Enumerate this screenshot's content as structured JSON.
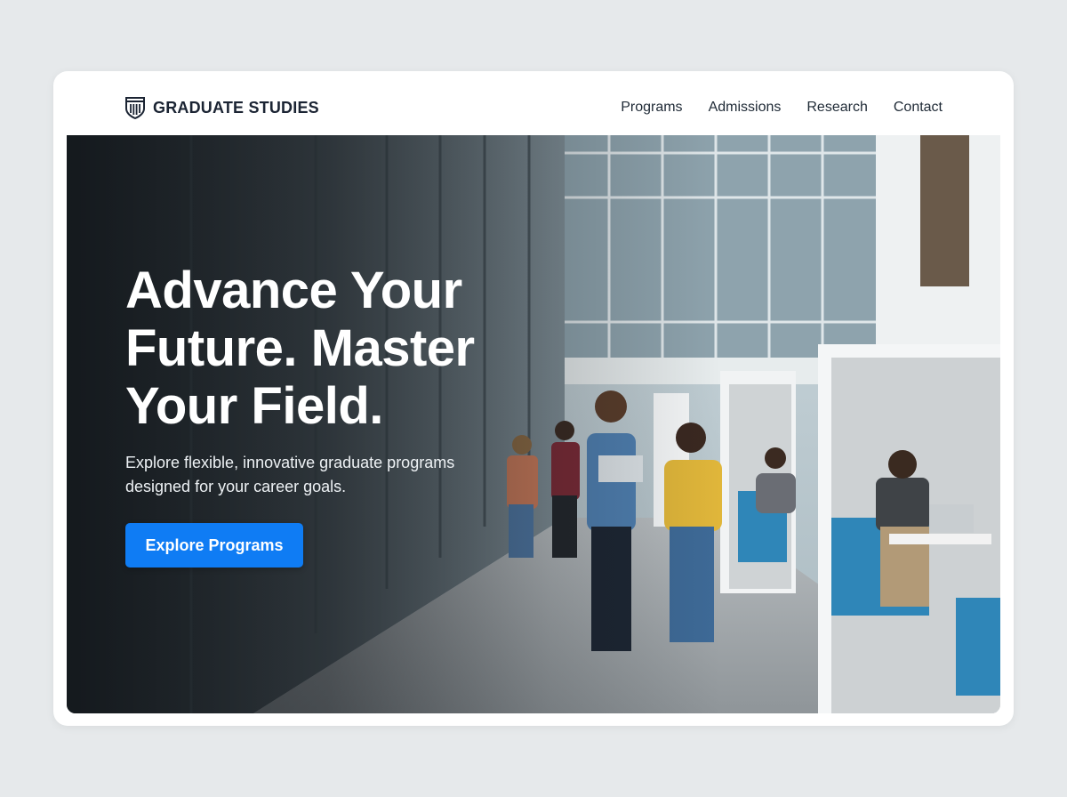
{
  "brand": {
    "name": "GRADUATE STUDIES",
    "logo_icon": "university-shield-icon"
  },
  "nav": {
    "items": [
      {
        "label": "Programs"
      },
      {
        "label": "Admissions"
      },
      {
        "label": "Research"
      },
      {
        "label": "Contact"
      }
    ]
  },
  "hero": {
    "headline": "Advance Your Future. Master Your Field.",
    "subtext": "Explore flexible, innovative graduate programs designed for your career goals.",
    "cta_label": "Explore Programs",
    "image": "students-walking-modern-campus-photo"
  },
  "colors": {
    "accent": "#0f7cf4",
    "brand_text": "#1b2433",
    "page_background": "#e6e9eb"
  }
}
